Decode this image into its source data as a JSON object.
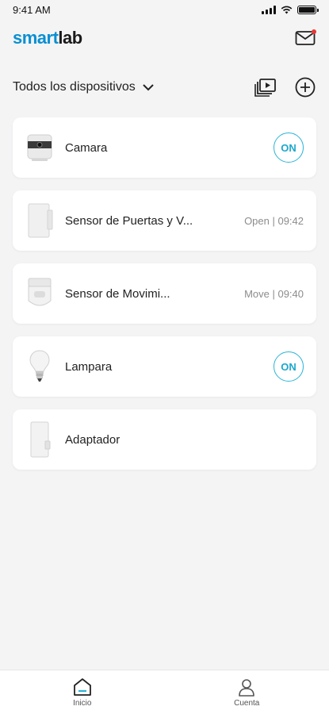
{
  "status_bar": {
    "time": "9:41 AM"
  },
  "header": {
    "logo_part1": "smart",
    "logo_part2": "lab",
    "mail_icon": "mail-icon"
  },
  "toolbar": {
    "filter_label": "Todos los dispositivos"
  },
  "devices": [
    {
      "name": "Camara",
      "status": "",
      "toggle": "ON",
      "icon": "camera-device-icon"
    },
    {
      "name": "Sensor de Puertas y V...",
      "status": "Open | 09:42",
      "toggle": "",
      "icon": "door-sensor-icon"
    },
    {
      "name": "Sensor de Movimi...",
      "status": "Move | 09:40",
      "toggle": "",
      "icon": "motion-sensor-icon"
    },
    {
      "name": "Lampara",
      "status": "",
      "toggle": "ON",
      "icon": "light-bulb-icon"
    },
    {
      "name": "Adaptador",
      "status": "",
      "toggle": "",
      "icon": "adapter-icon"
    }
  ],
  "bottom_nav": [
    {
      "label": "Inicio",
      "icon": "home-icon"
    },
    {
      "label": "Cuenta",
      "icon": "user-icon"
    }
  ],
  "colors": {
    "accent": "#2bb5d8",
    "brand_blue": "#0a8fd2",
    "notification": "#e53935"
  }
}
